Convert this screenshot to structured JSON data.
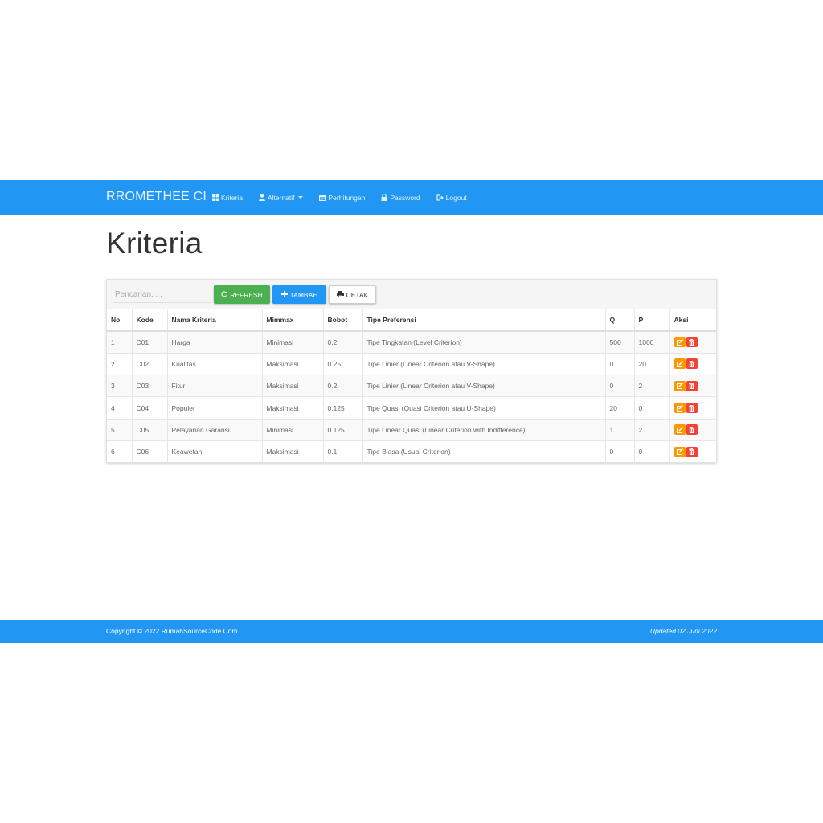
{
  "navbar": {
    "brand": "RROMETHEE CI",
    "items": [
      {
        "label": "Kriteria",
        "icon": "grid-icon"
      },
      {
        "label": "Alternatif",
        "icon": "user-icon"
      },
      {
        "label": "Perhitungan",
        "icon": "calendar-icon"
      },
      {
        "label": "Password",
        "icon": "lock-icon"
      },
      {
        "label": "Logout",
        "icon": "logout-icon"
      }
    ]
  },
  "page": {
    "title": "Kriteria"
  },
  "toolbar": {
    "search_placeholder": "Pencarian. . .",
    "refresh_label": "REFRESH",
    "tambah_label": "TAMBAH",
    "cetak_label": "CETAK"
  },
  "table": {
    "headers": [
      "No",
      "Kode",
      "Nama Kriteria",
      "Mimmax",
      "Bobot",
      "Tipe Preferensi",
      "Q",
      "P",
      "Aksi"
    ],
    "rows": [
      {
        "no": "1",
        "kode": "C01",
        "nama": "Harga",
        "minmax": "Minimasi",
        "bobot": "0.2",
        "tipe": "Tipe Tingkatan (Level Criterion)",
        "q": "500",
        "p": "1000"
      },
      {
        "no": "2",
        "kode": "C02",
        "nama": "Kualitas",
        "minmax": "Maksimasi",
        "bobot": "0.25",
        "tipe": "Tipe Linier (Linear Criterion atau V-Shape)",
        "q": "0",
        "p": "20"
      },
      {
        "no": "3",
        "kode": "C03",
        "nama": "Fitur",
        "minmax": "Maksimasi",
        "bobot": "0.2",
        "tipe": "Tipe Linier (Linear Criterion atau V-Shape)",
        "q": "0",
        "p": "2"
      },
      {
        "no": "4",
        "kode": "C04",
        "nama": "Populer",
        "minmax": "Maksimasi",
        "bobot": "0.125",
        "tipe": "Tipe Quasi (Quasi Criterion atau U-Shape)",
        "q": "20",
        "p": "0"
      },
      {
        "no": "5",
        "kode": "C05",
        "nama": "Pelayanan Garansi",
        "minmax": "Minimasi",
        "bobot": "0.125",
        "tipe": "Tipe Linear Quasi (Linear Criterion with Indifference)",
        "q": "1",
        "p": "2"
      },
      {
        "no": "6",
        "kode": "C06",
        "nama": "Keawetan",
        "minmax": "Maksimasi",
        "bobot": "0.1",
        "tipe": "Tipe Biasa (Usual Criterion)",
        "q": "0",
        "p": "0"
      }
    ]
  },
  "footer": {
    "copyright": "Copyright © 2022 RumahSourceCode.Com",
    "updated": "Updated 02 Juni 2022"
  },
  "colors": {
    "primary": "#2196f3",
    "success": "#4caf50",
    "warning": "#ff9800",
    "danger": "#f44336"
  }
}
